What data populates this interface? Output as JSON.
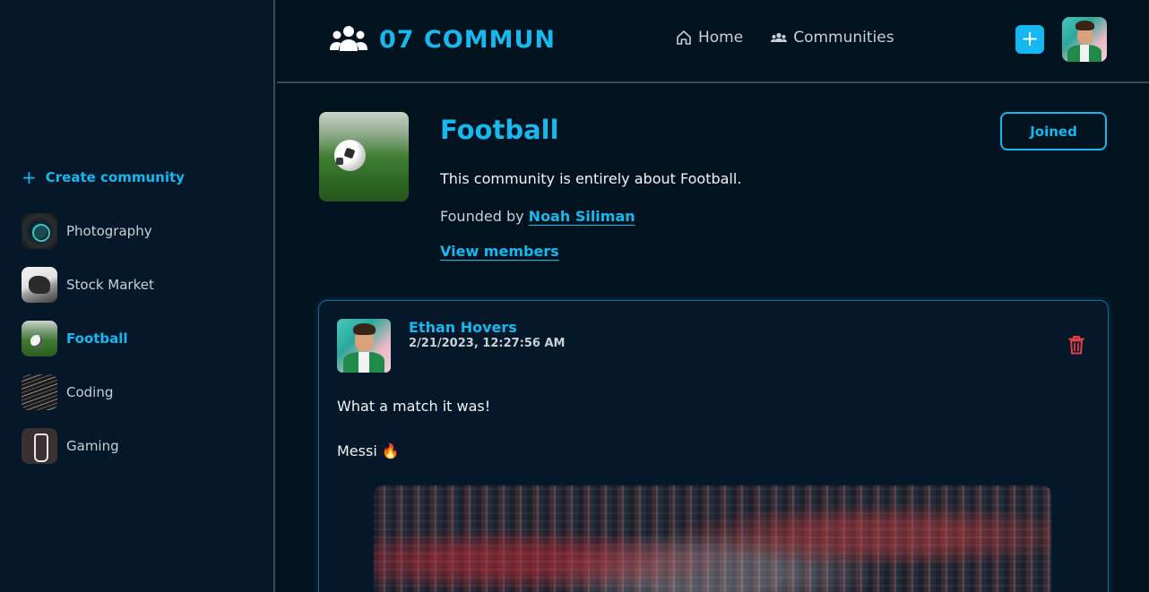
{
  "app": {
    "brand_title": "07 COMMUN",
    "accent_color": "#18b8ee"
  },
  "nav": {
    "home_label": "Home",
    "communities_label": "Communities",
    "add_label": "+"
  },
  "sidebar": {
    "create_label": "Create community",
    "items": [
      {
        "label": "Photography",
        "icon": "photography-thumb"
      },
      {
        "label": "Stock Market",
        "icon": "stock-market-thumb"
      },
      {
        "label": "Football",
        "icon": "football-thumb",
        "active": true
      },
      {
        "label": "Coding",
        "icon": "coding-thumb"
      },
      {
        "label": "Gaming",
        "icon": "gaming-thumb"
      }
    ]
  },
  "community": {
    "title": "Football",
    "description": "This community is entirely about Football.",
    "founded_prefix": "Founded by",
    "founder": "Noah Siliman",
    "view_members_label": "View members",
    "joined_label": "Joined"
  },
  "post": {
    "author": "Ethan Hovers",
    "date": "2/21/2023, 12:27:56 AM",
    "line1": "What a match it was!",
    "line2": "Messi 🔥"
  }
}
